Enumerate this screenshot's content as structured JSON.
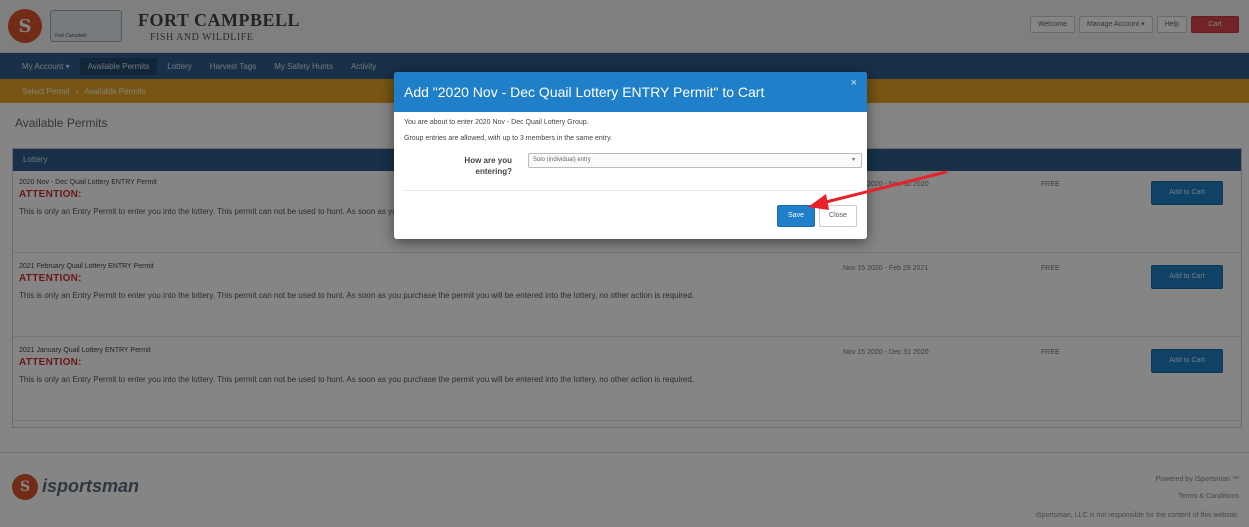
{
  "header": {
    "logo_letter": "S",
    "map_caption": "Fort Campbell",
    "org_title": "FORT CAMPBELL",
    "org_subtitle": "FISH AND WILDLIFE",
    "buttons": [
      "Welcome",
      "Manage Account ▾",
      "Help",
      "Cart"
    ]
  },
  "nav": {
    "items": [
      "My Account ▾",
      "Available Permits",
      "Lottery",
      "Harvest Tags",
      "My Safety Hunts",
      "Activity"
    ]
  },
  "breadcrumb": {
    "items": [
      "Select Permit",
      "›",
      "Available Permits"
    ]
  },
  "page": {
    "title": "Available Permits"
  },
  "panel": {
    "heading": "Lottery",
    "add_label": "Add to Cart",
    "rows": [
      {
        "name": "2020 Nov - Dec Quail Lottery ENTRY Permit",
        "attention": "ATTENTION:",
        "description": "This is only an Entry Permit to enter you into the lottery.  This permit can not be used to hunt.  As soon as you purchase the permit you will be entered into the lottery, no other action is required.",
        "dates": "Nov 15 2020 - Nov 30 2020",
        "price": "FREE"
      },
      {
        "name": "2021 February Quail Lottery ENTRY Permit",
        "attention": "ATTENTION:",
        "description": "This is only an Entry Permit to enter you into the lottery.  This permit can not be used to hunt.  As soon as you purchase the permit you will be entered into the lottery, no other action is required.",
        "dates": "Nov 15 2020 - Feb 28 2021",
        "price": "FREE"
      },
      {
        "name": "2021 January Quail Lottery ENTRY Permit",
        "attention": "ATTENTION:",
        "description": "This is only an Entry Permit to enter you into the lottery.  This permit can not be used to hunt.  As soon as you purchase the permit you will be entered into the lottery, no other action is required.",
        "dates": "Nov 15 2020 - Dec 31 2020",
        "price": "FREE"
      }
    ]
  },
  "footer": {
    "logo_letter": "S",
    "brand": "isportsman",
    "powered_by": "Powered by iSportsman ™",
    "terms": "Terms & Conditions",
    "disclaimer": "iSportsman, LLC is not responsible for the content of this website."
  },
  "modal": {
    "title": "Add \"2020 Nov - Dec Quail Lottery ENTRY Permit\" to Cart",
    "close_symbol": "×",
    "line1": "You are about to enter 2020 Nov - Dec Quail Lottery Group.",
    "line2": "Group entries are allowed, with up to 3 members in the same entry.",
    "question": "How are you entering?",
    "select_value": "Solo (individual) entry",
    "select_caret": "▾",
    "save_label": "Save",
    "close_label": "Close"
  },
  "colors": {
    "nav_blue": "#2f5d8a",
    "crumb_orange": "#e5a327",
    "modal_blue": "#1f7fc8",
    "attention_red": "#c9302c",
    "arrow_red": "#e8202a"
  }
}
